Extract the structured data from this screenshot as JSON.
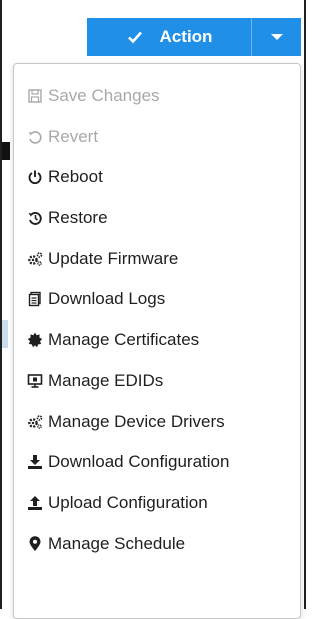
{
  "action_button": {
    "label": "Action"
  },
  "menu": {
    "items": [
      {
        "label": "Save Changes",
        "icon": "save-icon",
        "disabled": true
      },
      {
        "label": "Revert",
        "icon": "revert-icon",
        "disabled": true
      },
      {
        "label": "Reboot",
        "icon": "power-icon",
        "disabled": false
      },
      {
        "label": "Restore",
        "icon": "restore-icon",
        "disabled": false
      },
      {
        "label": "Update Firmware",
        "icon": "gears-icon",
        "disabled": false
      },
      {
        "label": "Download Logs",
        "icon": "logs-icon",
        "disabled": false
      },
      {
        "label": "Manage Certificates",
        "icon": "certificate-icon",
        "disabled": false
      },
      {
        "label": "Manage EDIDs",
        "icon": "monitor-icon",
        "disabled": false
      },
      {
        "label": "Manage Device Drivers",
        "icon": "gears-icon",
        "disabled": false
      },
      {
        "label": "Download Configuration",
        "icon": "download-icon",
        "disabled": false
      },
      {
        "label": "Upload Configuration",
        "icon": "upload-icon",
        "disabled": false
      },
      {
        "label": "Manage Schedule",
        "icon": "map-marker-icon",
        "disabled": false
      }
    ]
  },
  "colors": {
    "accent": "#1f8fe8",
    "disabled_text": "#a9a9a9",
    "text": "#1f1f1f"
  }
}
